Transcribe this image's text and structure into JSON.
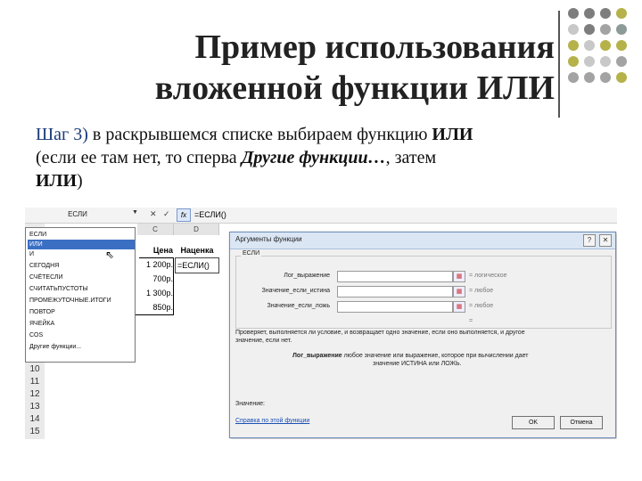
{
  "slide": {
    "title_line1": "Пример использования",
    "title_line2": "вложенной функции ИЛИ",
    "step_label": "Шаг 3)",
    "step_text_a": "в раскрывшемся списке выбираем функцию",
    "step_func": "ИЛИ",
    "step_text_b": "(если ее там нет, то сперва",
    "step_other": "Другие функции…",
    "step_text_c": ", затем",
    "step_func2": "ИЛИ",
    "step_close": ")"
  },
  "colors": {
    "dots": [
      "#7d7d7d",
      "#7d7d7d",
      "#7d7d7d",
      "#b5b24a",
      "#c8c8c8",
      "#7d7d7d",
      "#a3a3a3",
      "#8d9a9a",
      "#b5b24a",
      "#c8c8c8",
      "#b5b24a",
      "#b5b24a",
      "#b5b24a",
      "#c8c8c8",
      "#c8c8c8",
      "#a3a3a3",
      "#a3a3a3",
      "#a3a3a3",
      "#a3a3a3",
      "#b5b24a"
    ]
  },
  "excel": {
    "name_box": "ЕСЛИ",
    "formula": "=ЕСЛИ()",
    "fx": "fx",
    "cancel": "✕",
    "enter": "✓",
    "col_c": "C",
    "col_d": "D",
    "header_price": "Цена",
    "header_markup": "Наценка",
    "cells_price": [
      "1 200р.",
      "700р.",
      "1 300р.",
      "850р."
    ],
    "edit_cell": "=ЕСЛИ()",
    "row_numbers": [
      "10",
      "11",
      "12",
      "13",
      "14",
      "15"
    ],
    "function_list": [
      "ЕСЛИ",
      "ИЛИ",
      "И",
      "СЕГОДНЯ",
      "СЧЁТЕСЛИ",
      "СЧИТАТЬПУСТОТЫ",
      "ПРОМЕЖУТОЧНЫЕ.ИТОГИ",
      "ПОВТОР",
      "ЯЧЕЙКА",
      "COS",
      "Другие функции..."
    ],
    "selected_function_index": 1
  },
  "dialog": {
    "title": "Аргументы функции",
    "help": "?",
    "close": "✕",
    "group": "ЕСЛИ",
    "arg1": "Лог_выражение",
    "arg2": "Значение_если_истина",
    "arg3": "Значение_если_ложь",
    "eq": "=",
    "res1": "логическое",
    "res2": "любое",
    "res3": "любое",
    "res4": "=",
    "desc1": "Проверяет, выполняется ли условие, и возвращает одно значение, если оно выполняется, и другое",
    "desc1b": "значение, если нет.",
    "desc2_label": "Лог_выражение",
    "desc2": "любое значение или выражение, которое при вычислении дает",
    "desc2b": "значение ИСТИНА или ЛОЖЬ.",
    "value_label": "Значение:",
    "help_link": "Справка по этой функции",
    "ok": "OK",
    "cancel": "Отмена"
  }
}
